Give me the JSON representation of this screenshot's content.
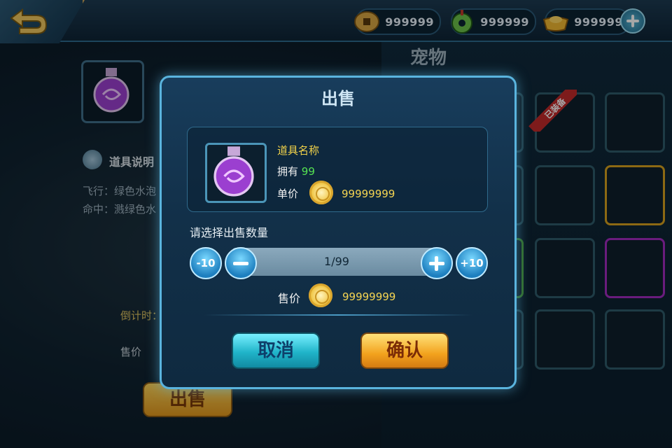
{
  "currency": {
    "copper": {
      "value": "999999",
      "icon": "copper-coin-icon"
    },
    "jade": {
      "value": "999999",
      "icon": "jade-icon"
    },
    "gold_ingot": {
      "value": "999999",
      "icon": "gold-ingot-icon"
    }
  },
  "pet_panel": {
    "title": "宠物",
    "equipped_tag": "已装备"
  },
  "left_panel": {
    "desc_title": "道具说明",
    "desc_lines": [
      "飞行：绿色水泡",
      "命中：溅绿色水"
    ],
    "countdown": "倒计时：",
    "price_label": "售价",
    "sell_button": "出售"
  },
  "dialog": {
    "title": "出售",
    "item_name": "道具名称",
    "own_label": "拥有",
    "own_count": "99",
    "unit_price_label": "单价",
    "unit_price_value": "99999999",
    "choose_label": "请选择出售数量",
    "minus10": "-10",
    "plus10": "+10",
    "quantity": "1/99",
    "sale_price_label": "售价",
    "sale_price_value": "99999999",
    "cancel": "取消",
    "confirm": "确认"
  },
  "colors": {
    "accent_gold": "#f5d552",
    "own_green": "#56e352",
    "dialog_border": "#5ab4de"
  }
}
